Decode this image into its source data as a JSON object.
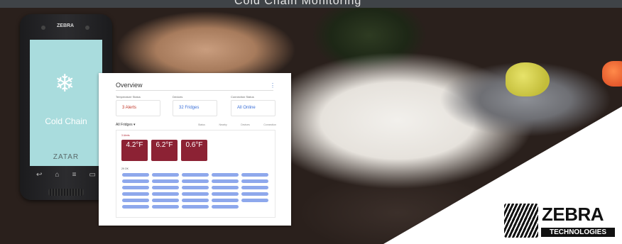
{
  "banner": {
    "title": "Cold Chain Monitoring",
    "colors": {
      "topbar": "#3f4347"
    }
  },
  "phone": {
    "brand": "ZEBRA",
    "icon": "snowflake-icon",
    "app_title": "Cold Chain",
    "app_brand": "ZATAR",
    "nav": [
      "back-icon",
      "home-icon",
      "menu-icon",
      "recent-icon"
    ]
  },
  "dashboard": {
    "title": "Overview",
    "menu_icon": "kebab-icon",
    "tiles": [
      {
        "label": "Temperature Status",
        "value": "3 Alerts",
        "icon": "bell-icon",
        "color": "#c0392b"
      },
      {
        "label": "Devices",
        "value": "32 Fridges",
        "icon": "fridge-icon",
        "color": "#3a6fd8"
      },
      {
        "label": "Connection Status",
        "value": "All Online",
        "icon": "globe-icon",
        "color": "#3a6fd8"
      }
    ],
    "fridges_header": "All Fridges ▾",
    "filters": [
      "Status",
      "Nearby",
      "Devices",
      "Connection"
    ],
    "alerts_label": "3 Alerts",
    "alerts": [
      {
        "name": "",
        "temp": "4.2°F"
      },
      {
        "name": "",
        "temp": "6.2°F"
      },
      {
        "name": "",
        "temp": "0.6°F"
      }
    ],
    "ok_label": "29 OK",
    "ok_count": 29
  },
  "logo": {
    "line1": "ZEBRA",
    "line2": "TECHNOLOGIES"
  }
}
